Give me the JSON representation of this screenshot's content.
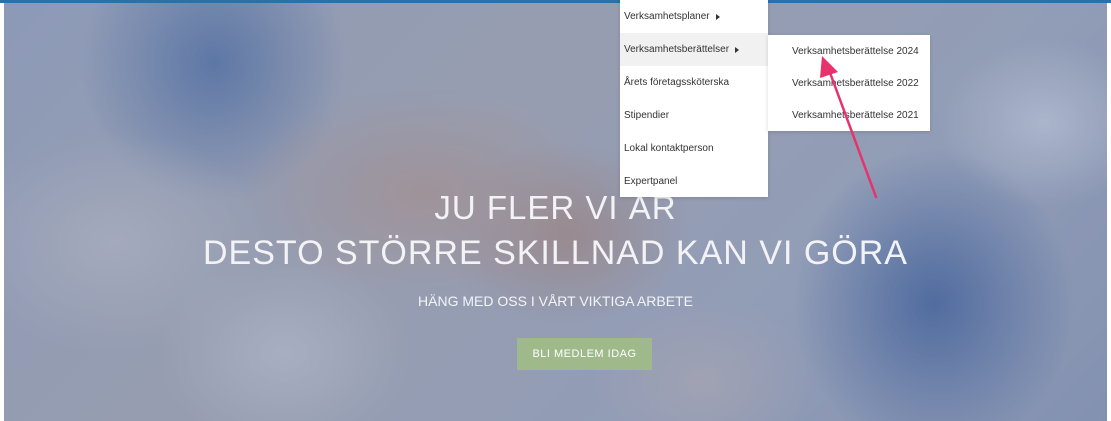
{
  "colors": {
    "accent_line": "#2d6fa8",
    "cta_background": "#9fb98a",
    "annotation_arrow": "#e8326e",
    "overlay": "rgba(70,95,150,0.38)"
  },
  "hero": {
    "title_line1": "JU FLER VI ÄR",
    "title_line2": "DESTO STÖRRE SKILLNAD KAN VI GÖRA",
    "subtitle": "HÄNG MED OSS I VÅRT VIKTIGA ARBETE",
    "cta_label": "BLI MEDLEM IDAG"
  },
  "dropdown": {
    "items": [
      {
        "label": "Verksamhetsplaner",
        "has_submenu": true
      },
      {
        "label": "Verksamhetsberättelser",
        "has_submenu": true,
        "active": true
      },
      {
        "label": "Årets företagssköterska",
        "has_submenu": false
      },
      {
        "label": "Stipendier",
        "has_submenu": false
      },
      {
        "label": "Lokal kontaktperson",
        "has_submenu": false
      },
      {
        "label": "Expertpanel",
        "has_submenu": false
      }
    ]
  },
  "submenu": {
    "items": [
      {
        "label": "Verksamhetsberättelse 2024"
      },
      {
        "label": "Verksamhetsberättelse 2022"
      },
      {
        "label": "Verksamhetsberättelse 2021"
      }
    ]
  }
}
